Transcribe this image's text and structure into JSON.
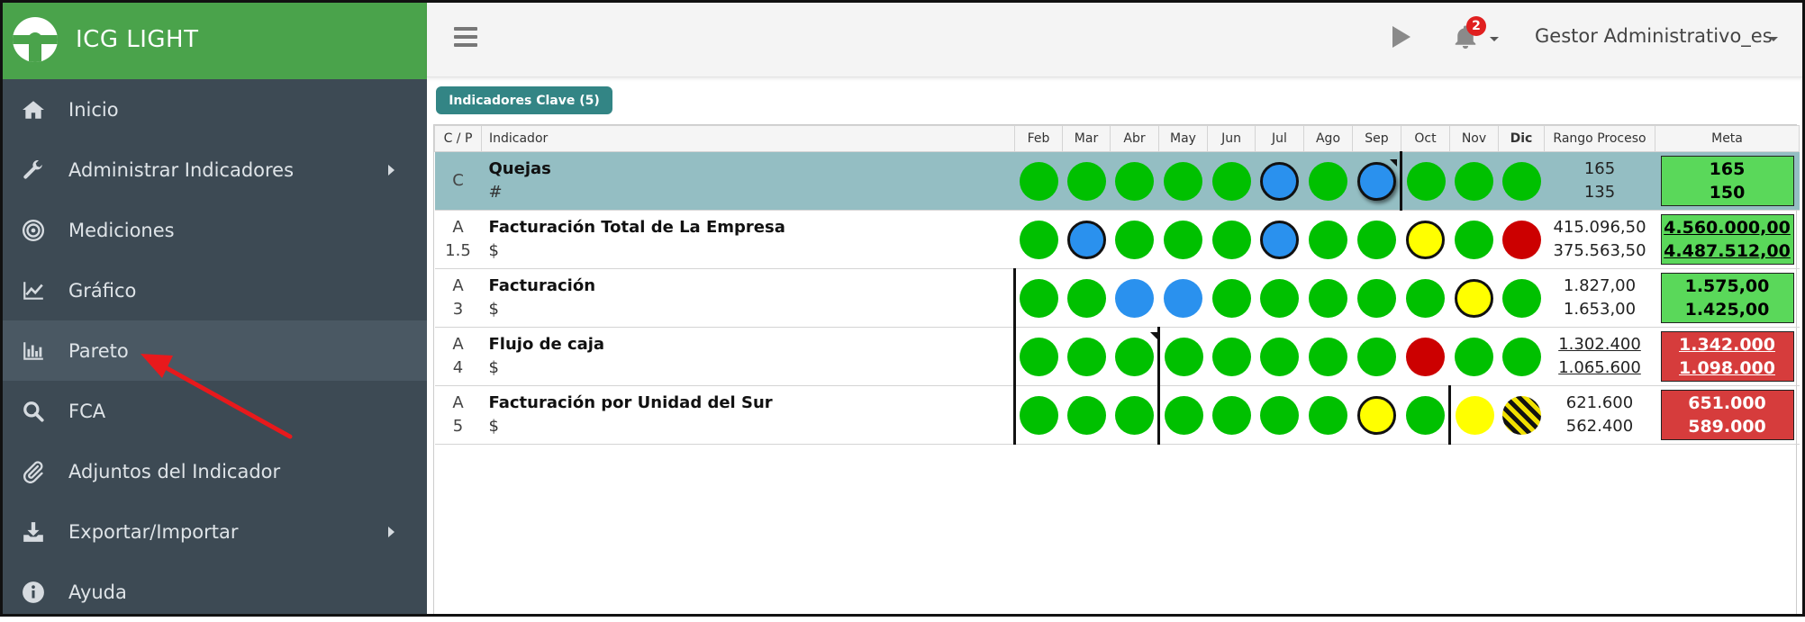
{
  "app": {
    "title": "ICG LIGHT"
  },
  "sidebar": {
    "items": [
      {
        "label": "Inicio",
        "icon": "home-icon"
      },
      {
        "label": "Administrar Indicadores",
        "icon": "wrench-icon"
      },
      {
        "label": "Mediciones",
        "icon": "target-icon"
      },
      {
        "label": "Gráfico",
        "icon": "line-chart-icon"
      },
      {
        "label": "Pareto",
        "icon": "bar-chart-icon"
      },
      {
        "label": "FCA",
        "icon": "search-icon"
      },
      {
        "label": "Adjuntos del Indicador",
        "icon": "paperclip-icon"
      },
      {
        "label": "Exportar/Importar",
        "icon": "download-icon"
      },
      {
        "label": "Ayuda",
        "icon": "info-icon"
      }
    ]
  },
  "header": {
    "notifications_count": "2",
    "user": "Gestor Administrativo_es"
  },
  "main": {
    "tab_label": "Indicadores Clave (5)",
    "columns": {
      "cp": "C / P",
      "indicador": "Indicador",
      "months": [
        "Feb",
        "Mar",
        "Abr",
        "May",
        "Jun",
        "Jul",
        "Ago",
        "Sep",
        "Oct",
        "Nov",
        "Dic"
      ],
      "rango": "Rango Proceso",
      "meta": "Meta"
    },
    "rows": [
      {
        "cp_top": "C",
        "cp_bottom": "",
        "name": "Quejas",
        "unit": "#",
        "range_top": "165",
        "range_bottom": "135",
        "meta_top": "165",
        "meta_bottom": "150"
      },
      {
        "cp_top": "A",
        "cp_bottom": "1.5",
        "name": "Facturación Total de La Empresa",
        "unit": "$",
        "range_top": "415.096,50",
        "range_bottom": "375.563,50",
        "meta_top": "4.560.000,00",
        "meta_bottom": "4.487.512,00"
      },
      {
        "cp_top": "A",
        "cp_bottom": "3",
        "name": "Facturación",
        "unit": "$",
        "range_top": "1.827,00",
        "range_bottom": "1.653,00",
        "meta_top": "1.575,00",
        "meta_bottom": "1.425,00"
      },
      {
        "cp_top": "A",
        "cp_bottom": "4",
        "name": "Flujo de caja",
        "unit": "$",
        "range_top": "1.302.400",
        "range_bottom": "1.065.600",
        "meta_top": "1.342.000",
        "meta_bottom": "1.098.000"
      },
      {
        "cp_top": "A",
        "cp_bottom": "5",
        "name": "Facturación por Unidad del Sur",
        "unit": "$",
        "range_top": "621.600",
        "range_bottom": "562.400",
        "meta_top": "651.000",
        "meta_bottom": "589.000"
      }
    ]
  },
  "colors": {
    "brand": "#4aa34b",
    "sidebar": "#3d4a54",
    "selected_row": "#94bec3",
    "status_green": "#00c000",
    "status_blue": "#2a91ee",
    "status_yellow": "#ffff00",
    "status_red": "#cc0000",
    "meta_green": "#5ad85a",
    "meta_red": "#d63c3c",
    "annotation_arrow": "#e8191c"
  }
}
